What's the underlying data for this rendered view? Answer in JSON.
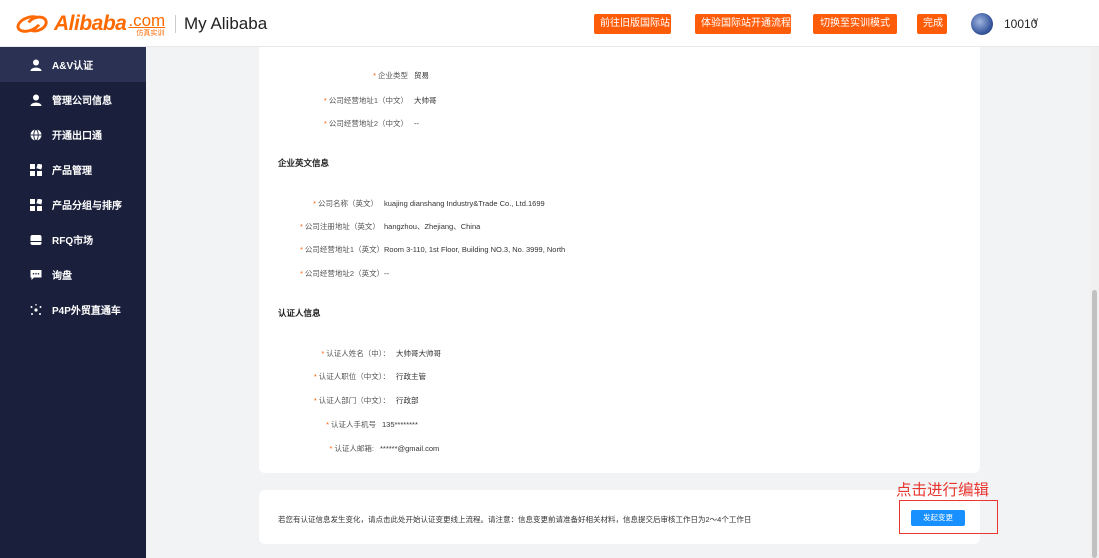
{
  "header": {
    "logo_text": "Alibaba",
    "logo_com": ".com",
    "logo_sub": "仿真实训",
    "title": "My Alibaba",
    "buttons": [
      {
        "label": "前往旧版国际站"
      },
      {
        "label": "体验国际站开通流程"
      },
      {
        "label": "切换至实训模式"
      },
      {
        "label": "完成"
      }
    ],
    "user_id": "10010",
    "chevron": "∨"
  },
  "sidebar": {
    "items": [
      {
        "label": "A&V认证",
        "icon": "user-icon",
        "active": true
      },
      {
        "label": "管理公司信息",
        "icon": "user-icon"
      },
      {
        "label": "开通出口通",
        "icon": "globe-icon"
      },
      {
        "label": "产品管理",
        "icon": "grid-icon"
      },
      {
        "label": "产品分组与排序",
        "icon": "grid-icon"
      },
      {
        "label": "RFQ市场",
        "icon": "box-icon"
      },
      {
        "label": "询盘",
        "icon": "chat-icon"
      },
      {
        "label": "P4P外贸直通车",
        "icon": "sparkle-icon"
      }
    ]
  },
  "content": {
    "top_rows": [
      {
        "label": "企业类型",
        "value": "贸易"
      },
      {
        "label": "公司经营地址1（中文）",
        "value": "大帅哥"
      },
      {
        "label": "公司经营地址2（中文）",
        "value": "--"
      }
    ],
    "section_en_title": "企业英文信息",
    "en_rows": [
      {
        "label": "公司名称（英文）",
        "value": "kuajing dianshang Industry&Trade Co., Ltd.1699"
      },
      {
        "label": "公司注册地址（英文）",
        "value": "hangzhou、Zhejiang、China"
      },
      {
        "label": "公司经营地址1（英文）",
        "value": "Room 3-110, 1st Floor, Building NO.3, No. 3999, North"
      },
      {
        "label": "公司经营地址2（英文）",
        "value": "--"
      }
    ],
    "section_cert_title": "认证人信息",
    "cert_rows": [
      {
        "label": "认证人姓名（中）：",
        "value": "大帅哥大帅哥"
      },
      {
        "label": "认证人职位（中文）：",
        "value": "行政主管"
      },
      {
        "label": "认证人部门（中文）：",
        "value": "行政部"
      },
      {
        "label": "认证人手机号",
        "value": "135********"
      },
      {
        "label": "认证人邮箱:",
        "value": "******@gmail.com"
      }
    ]
  },
  "footer": {
    "notice": "若您有认证信息发生变化，请点击此处开始认证变更线上流程。请注意：信息变更前请准备好相关材料，信息提交后审核工作日为2～4个工作日",
    "action_label": "发起变更",
    "annotation": "点击进行编辑"
  },
  "colors": {
    "accent": "#ff5c0a",
    "sidebar_bg": "#1a1f3c",
    "primary": "#1890ff",
    "annotation": "#e8362f"
  }
}
